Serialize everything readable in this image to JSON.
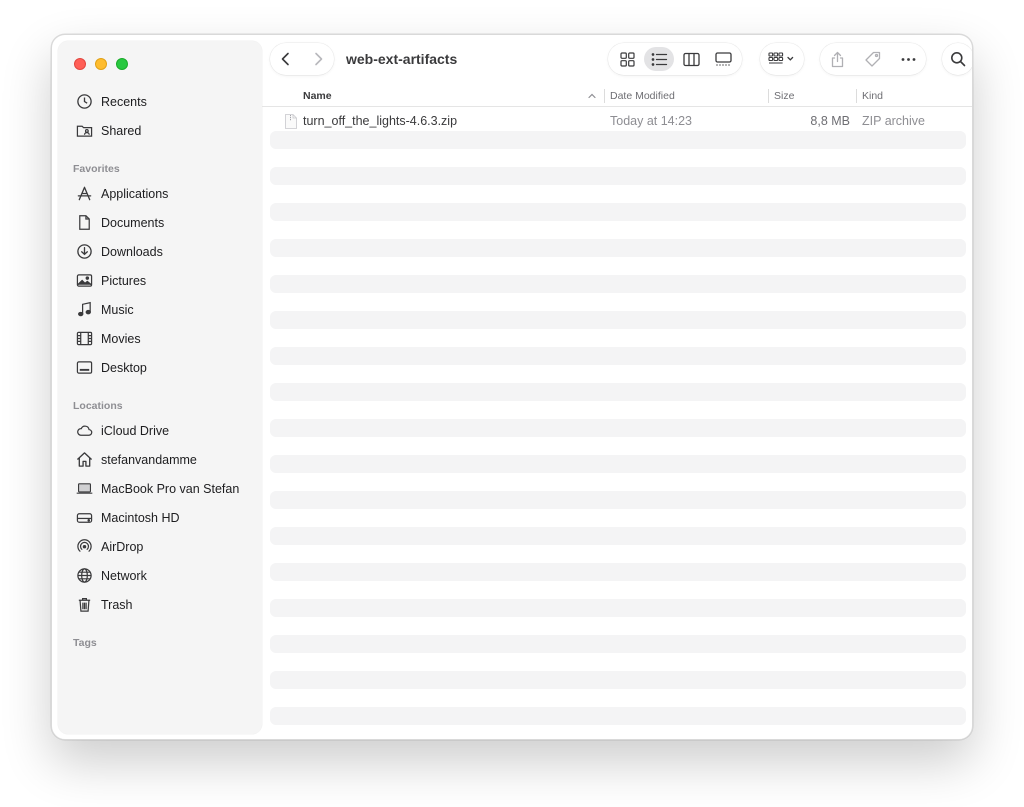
{
  "window": {
    "title": "web-ext-artifacts"
  },
  "sidebar": {
    "top_items": [
      {
        "label": "Recents",
        "icon": "clock-icon"
      },
      {
        "label": "Shared",
        "icon": "shared-folder-icon"
      }
    ],
    "favorites_header": "Favorites",
    "favorites": [
      {
        "label": "Applications",
        "icon": "applications-icon"
      },
      {
        "label": "Documents",
        "icon": "document-icon"
      },
      {
        "label": "Downloads",
        "icon": "download-icon"
      },
      {
        "label": "Pictures",
        "icon": "photo-icon"
      },
      {
        "label": "Music",
        "icon": "music-note-icon"
      },
      {
        "label": "Movies",
        "icon": "film-icon"
      },
      {
        "label": "Desktop",
        "icon": "desktop-icon"
      }
    ],
    "locations_header": "Locations",
    "locations": [
      {
        "label": "iCloud Drive",
        "icon": "cloud-icon"
      },
      {
        "label": "stefanvandamme",
        "icon": "home-icon"
      },
      {
        "label": "MacBook Pro van Stefan",
        "icon": "laptop-icon"
      },
      {
        "label": "Macintosh HD",
        "icon": "hard-drive-icon"
      },
      {
        "label": "AirDrop",
        "icon": "airdrop-icon"
      },
      {
        "label": "Network",
        "icon": "globe-icon"
      },
      {
        "label": "Trash",
        "icon": "trash-icon"
      }
    ],
    "tags_header": "Tags"
  },
  "columns": {
    "name": "Name",
    "date_modified": "Date Modified",
    "size": "Size",
    "kind": "Kind",
    "sort_direction": "ascending"
  },
  "files": [
    {
      "name": "turn_off_the_lights-4.6.3.zip",
      "date_modified": "Today at 14:23",
      "size": "8,8 MB",
      "kind": "ZIP archive",
      "icon": "zip-file-icon"
    }
  ],
  "toolbar": {
    "active_view": "list",
    "views": [
      "icon",
      "list",
      "column",
      "gallery"
    ]
  },
  "colors": {
    "close": "#ff5f57",
    "minimize": "#febc2e",
    "maximize": "#28c840",
    "stripe": "#f4f4f5",
    "sidebar": "#f5f5f5"
  }
}
